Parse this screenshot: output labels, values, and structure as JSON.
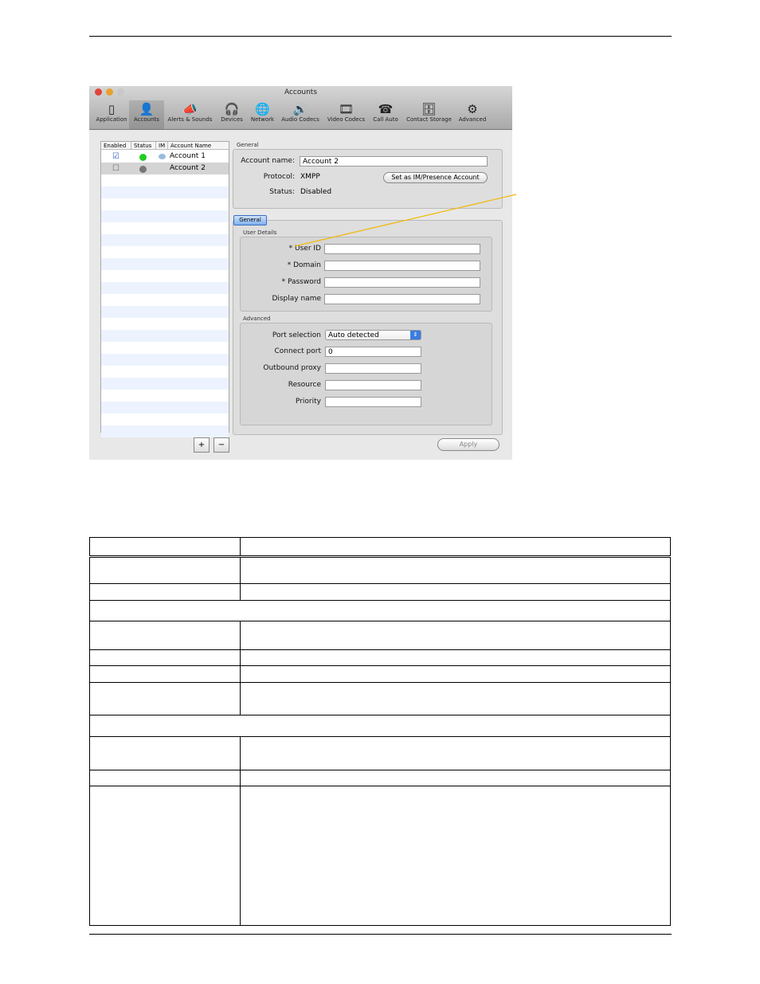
{
  "window": {
    "title": "Accounts"
  },
  "toolbar": [
    {
      "label": "Application",
      "icon": "switch-icon"
    },
    {
      "label": "Accounts",
      "icon": "person-icon"
    },
    {
      "label": "Alerts & Sounds",
      "icon": "megaphone-icon"
    },
    {
      "label": "Devices",
      "icon": "headset-icon"
    },
    {
      "label": "Network",
      "icon": "globe-icon"
    },
    {
      "label": "Audio Codecs",
      "icon": "speaker-icon"
    },
    {
      "label": "Video Codecs",
      "icon": "film-icon"
    },
    {
      "label": "Call Auto",
      "icon": "phone-icon"
    },
    {
      "label": "Contact Storage",
      "icon": "storage-icon"
    },
    {
      "label": "Advanced",
      "icon": "gear-icon"
    }
  ],
  "accounts_list": {
    "headers": [
      "Enabled",
      "Status",
      "IM",
      "Account Name"
    ],
    "rows": [
      {
        "enabled": true,
        "status": "online",
        "im": true,
        "name": "Account 1"
      },
      {
        "enabled": false,
        "status": "disabled",
        "im": false,
        "name": "Account 2"
      }
    ],
    "add_label": "+",
    "remove_label": "−"
  },
  "general": {
    "section": "General",
    "account_name_label": "Account name:",
    "account_name": "Account 2",
    "protocol_label": "Protocol:",
    "protocol": "XMPP",
    "status_label": "Status:",
    "status": "Disabled",
    "set_im_button": "Set as IM/Presence Account"
  },
  "tab": "General",
  "user_details": {
    "section": "User Details",
    "fields": [
      {
        "label": "* User ID",
        "value": ""
      },
      {
        "label": "* Domain",
        "value": ""
      },
      {
        "label": "* Password",
        "value": ""
      },
      {
        "label": "Display name",
        "value": ""
      }
    ]
  },
  "advanced": {
    "section": "Advanced",
    "port_selection_label": "Port selection",
    "port_selection": "Auto detected",
    "fields": [
      {
        "label": "Connect port",
        "value": "0"
      },
      {
        "label": "Outbound proxy",
        "value": ""
      },
      {
        "label": "Resource",
        "value": ""
      },
      {
        "label": "Priority",
        "value": ""
      }
    ]
  },
  "apply_label": "Apply",
  "callout_color": "#f2b800"
}
